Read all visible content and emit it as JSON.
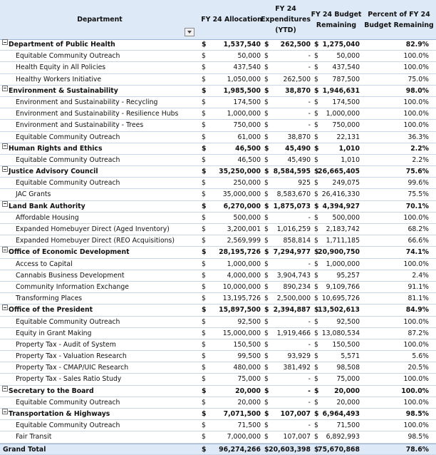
{
  "header": {
    "department": "Department",
    "allocation": "FY 24 Allocation",
    "expenditures": "FY 24 Expenditures (YTD)",
    "remaining": "FY 24 Budget Remaining",
    "percent": "Percent of FY 24 Budget Remaining"
  },
  "rows": [
    {
      "type": "group",
      "name": "Department of Public Health",
      "alloc": "1,537,540",
      "exp": "262,500",
      "rem": "1,275,040",
      "pct": "82.9%"
    },
    {
      "type": "item",
      "name": "Equitable Community Outreach",
      "alloc": "50,000",
      "exp": "-",
      "rem": "50,000",
      "pct": "100.0%"
    },
    {
      "type": "item",
      "name": "Health Equity in All Policies",
      "alloc": "437,540",
      "exp": "-",
      "rem": "437,540",
      "pct": "100.0%"
    },
    {
      "type": "item",
      "name": "Healthy Workers Initiative",
      "alloc": "1,050,000",
      "exp": "262,500",
      "rem": "787,500",
      "pct": "75.0%"
    },
    {
      "type": "group",
      "name": "Environment & Sustainability",
      "alloc": "1,985,500",
      "exp": "38,870",
      "rem": "1,946,631",
      "pct": "98.0%"
    },
    {
      "type": "item",
      "name": "Environment and Sustainability - Recycling",
      "alloc": "174,500",
      "exp": "-",
      "rem": "174,500",
      "pct": "100.0%"
    },
    {
      "type": "item",
      "name": "Environment and Sustainability - Resilience Hubs",
      "alloc": "1,000,000",
      "exp": "-",
      "rem": "1,000,000",
      "pct": "100.0%"
    },
    {
      "type": "item",
      "name": "Environment and Sustainability - Trees",
      "alloc": "750,000",
      "exp": "-",
      "rem": "750,000",
      "pct": "100.0%"
    },
    {
      "type": "item",
      "name": "Equitable Community Outreach",
      "alloc": "61,000",
      "exp": "38,870",
      "rem": "22,131",
      "pct": "36.3%"
    },
    {
      "type": "group",
      "name": "Human Rights and Ethics",
      "alloc": "46,500",
      "exp": "45,490",
      "rem": "1,010",
      "pct": "2.2%"
    },
    {
      "type": "item",
      "name": "Equitable Community Outreach",
      "alloc": "46,500",
      "exp": "45,490",
      "rem": "1,010",
      "pct": "2.2%"
    },
    {
      "type": "group",
      "name": "Justice Advisory Council",
      "alloc": "35,250,000",
      "exp": "8,584,595",
      "rem": "26,665,405",
      "pct": "75.6%"
    },
    {
      "type": "item",
      "name": "Equitable Community Outreach",
      "alloc": "250,000",
      "exp": "925",
      "rem": "249,075",
      "pct": "99.6%"
    },
    {
      "type": "item",
      "name": "JAC Grants",
      "alloc": "35,000,000",
      "exp": "8,583,670",
      "rem": "26,416,330",
      "pct": "75.5%"
    },
    {
      "type": "group",
      "name": "Land Bank Authority",
      "alloc": "6,270,000",
      "exp": "1,875,073",
      "rem": "4,394,927",
      "pct": "70.1%"
    },
    {
      "type": "item",
      "name": "Affordable Housing",
      "alloc": "500,000",
      "exp": "-",
      "rem": "500,000",
      "pct": "100.0%"
    },
    {
      "type": "item",
      "name": "Expanded Homebuyer Direct (Aged Inventory)",
      "alloc": "3,200,001",
      "exp": "1,016,259",
      "rem": "2,183,742",
      "pct": "68.2%"
    },
    {
      "type": "item",
      "name": "Expanded Homebuyer Direct (REO Acquisitions)",
      "alloc": "2,569,999",
      "exp": "858,814",
      "rem": "1,711,185",
      "pct": "66.6%"
    },
    {
      "type": "group",
      "name": "Office of Economic Development",
      "alloc": "28,195,726",
      "exp": "7,294,977",
      "rem": "20,900,750",
      "pct": "74.1%"
    },
    {
      "type": "item",
      "name": "Access to Capital",
      "alloc": "1,000,000",
      "exp": "-",
      "rem": "1,000,000",
      "pct": "100.0%"
    },
    {
      "type": "item",
      "name": "Cannabis Business Development",
      "alloc": "4,000,000",
      "exp": "3,904,743",
      "rem": "95,257",
      "pct": "2.4%"
    },
    {
      "type": "item",
      "name": "Community Information Exchange",
      "alloc": "10,000,000",
      "exp": "890,234",
      "rem": "9,109,766",
      "pct": "91.1%"
    },
    {
      "type": "item",
      "name": "Transforming Places",
      "alloc": "13,195,726",
      "exp": "2,500,000",
      "rem": "10,695,726",
      "pct": "81.1%"
    },
    {
      "type": "group",
      "name": "Office of the President",
      "alloc": "15,897,500",
      "exp": "2,394,887",
      "rem": "13,502,613",
      "pct": "84.9%"
    },
    {
      "type": "item",
      "name": "Equitable Community Outreach",
      "alloc": "92,500",
      "exp": "-",
      "rem": "92,500",
      "pct": "100.0%"
    },
    {
      "type": "item",
      "name": "Equity in Grant Making",
      "alloc": "15,000,000",
      "exp": "1,919,466",
      "rem": "13,080,534",
      "pct": "87.2%"
    },
    {
      "type": "item",
      "name": "Property Tax - Audit of System",
      "alloc": "150,500",
      "exp": "-",
      "rem": "150,500",
      "pct": "100.0%"
    },
    {
      "type": "item",
      "name": "Property Tax - Valuation Research",
      "alloc": "99,500",
      "exp": "93,929",
      "rem": "5,571",
      "pct": "5.6%"
    },
    {
      "type": "item",
      "name": "Property Tax - CMAP/UIC Research",
      "alloc": "480,000",
      "exp": "381,492",
      "rem": "98,508",
      "pct": "20.5%"
    },
    {
      "type": "item",
      "name": "Property Tax - Sales Ratio Study",
      "alloc": "75,000",
      "exp": "-",
      "rem": "75,000",
      "pct": "100.0%"
    },
    {
      "type": "group",
      "name": "Secretary to the Board",
      "alloc": "20,000",
      "exp": "-",
      "rem": "20,000",
      "pct": "100.0%"
    },
    {
      "type": "item",
      "name": "Equitable Community Outreach",
      "alloc": "20,000",
      "exp": "-",
      "rem": "20,000",
      "pct": "100.0%"
    },
    {
      "type": "group",
      "name": "Transportation & Highways",
      "alloc": "7,071,500",
      "exp": "107,007",
      "rem": "6,964,493",
      "pct": "98.5%"
    },
    {
      "type": "item",
      "name": "Equitable Community Outreach",
      "alloc": "71,500",
      "exp": "-",
      "rem": "71,500",
      "pct": "100.0%"
    },
    {
      "type": "item",
      "name": "Fair Transit",
      "alloc": "7,000,000",
      "exp": "107,007",
      "rem": "6,892,993",
      "pct": "98.5%"
    }
  ],
  "total": {
    "name": "Grand Total",
    "alloc": "96,274,266",
    "exp": "20,603,398",
    "rem": "75,670,868",
    "pct": "78.6%"
  },
  "currency_symbol": "$"
}
